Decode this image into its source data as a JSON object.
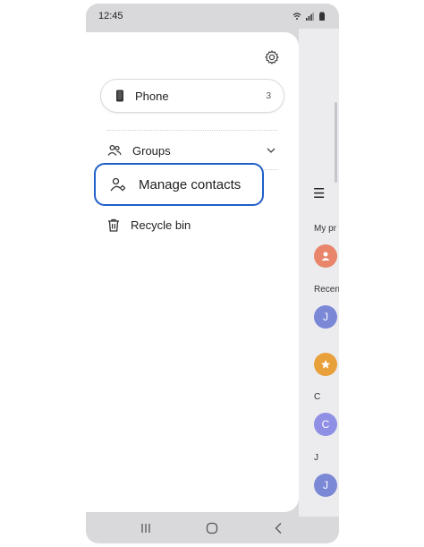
{
  "status_bar": {
    "time": "12:45"
  },
  "drawer": {
    "storage": {
      "label": "Phone",
      "count": "3"
    },
    "items": [
      {
        "label": "Groups"
      },
      {
        "label": "Manage contacts"
      },
      {
        "label": "Recycle bin"
      }
    ]
  },
  "background": {
    "labels": [
      "My pr",
      "Recen",
      "C",
      "J"
    ],
    "avatars": [
      {
        "letter": "",
        "color": "#e8856a"
      },
      {
        "letter": "J",
        "color": "#7b88d6"
      },
      {
        "letter": "",
        "color": "#e8a03a"
      },
      {
        "letter": "C",
        "color": "#8f8fe6"
      },
      {
        "letter": "J",
        "color": "#7b88d6"
      }
    ]
  },
  "colors": {
    "highlight_border": "#1f5fc8",
    "drawer_bg": "#ffffff",
    "device_bg": "#d9d9dc"
  }
}
